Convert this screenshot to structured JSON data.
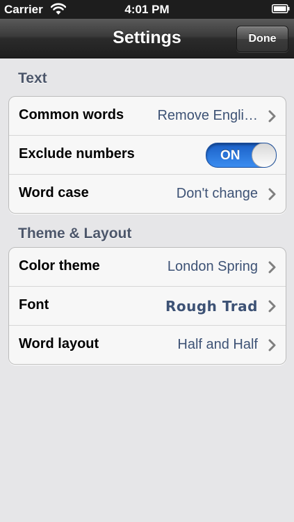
{
  "status_bar": {
    "carrier": "Carrier",
    "time": "4:01 PM"
  },
  "nav": {
    "title": "Settings",
    "done_label": "Done"
  },
  "sections": {
    "text": {
      "header": "Text",
      "common_words": {
        "label": "Common words",
        "value": "Remove Engli…"
      },
      "exclude_numbers": {
        "label": "Exclude numbers",
        "toggle": "ON",
        "state": true
      },
      "word_case": {
        "label": "Word case",
        "value": "Don't change"
      }
    },
    "theme": {
      "header": "Theme & Layout",
      "color_theme": {
        "label": "Color theme",
        "value": "London Spring"
      },
      "font": {
        "label": "Font",
        "value": "Rough Trad"
      },
      "word_layout": {
        "label": "Word layout",
        "value": "Half and Half"
      }
    }
  },
  "colors": {
    "accent": "#3b8df0",
    "value_text": "#3d5275",
    "section_header": "#4c566a",
    "background": "#e6e6e8"
  },
  "icons": [
    "wifi-icon",
    "battery-icon",
    "chevron-right-icon"
  ]
}
